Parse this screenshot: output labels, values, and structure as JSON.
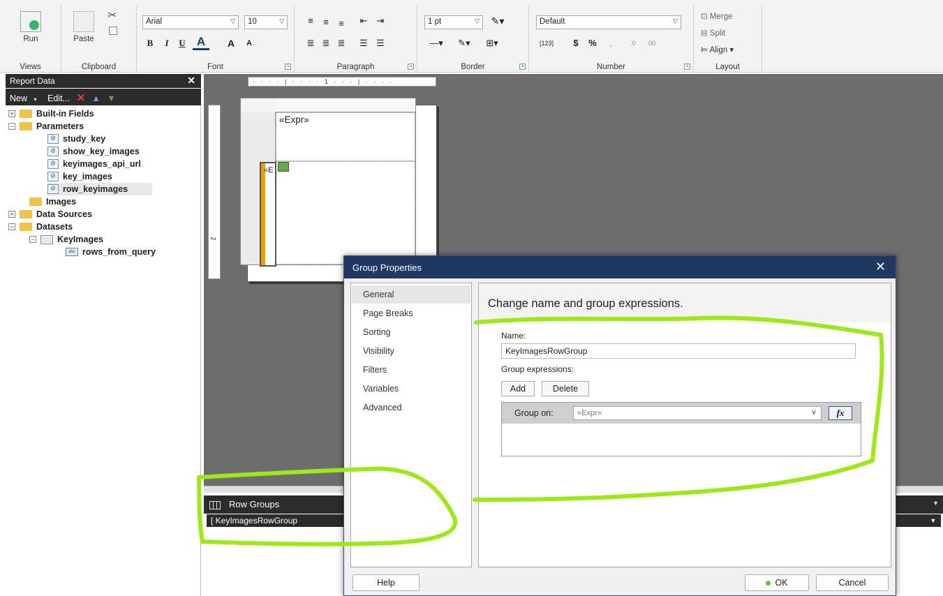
{
  "ribbon": {
    "groups": {
      "views": "Views",
      "clipboard": "Clipboard",
      "font": "Font",
      "paragraph": "Paragraph",
      "border": "Border",
      "number": "Number",
      "layout": "Layout"
    },
    "run_label": "Run",
    "paste_label": "Paste",
    "font_name": "Arial",
    "font_size": "10",
    "border_width": "1 pt",
    "number_format": "Default",
    "merge_label": "Merge",
    "split_label": "Split",
    "align_label": "Align",
    "bold": "B",
    "italic": "I",
    "underline": "U",
    "font_color": "A",
    "grow_font": "A",
    "shrink_font": "A",
    "placeholder_btn": "[123]",
    "currency": "$",
    "percent": "%",
    "comma": ",",
    "inc_decimals": ".0",
    "dec_decimals": ".00"
  },
  "report_data": {
    "title": "Report Data",
    "close": "✕",
    "toolbar": {
      "new": "New",
      "edit": "Edit...",
      "delete_icon": "red-x",
      "up_icon": "arrow-up",
      "down_icon": "arrow-down"
    },
    "tree": [
      {
        "label": "Built-in Fields",
        "type": "folder",
        "exp": "+"
      },
      {
        "label": "Parameters",
        "type": "folder-open",
        "exp": "−"
      },
      {
        "label": "study_key",
        "type": "param"
      },
      {
        "label": "show_key_images",
        "type": "param"
      },
      {
        "label": "keyimages_api_url",
        "type": "param"
      },
      {
        "label": "key_images",
        "type": "param"
      },
      {
        "label": "row_keyimages",
        "type": "param"
      },
      {
        "label": "Images",
        "type": "folder"
      },
      {
        "label": "Data Sources",
        "type": "folder",
        "exp": "+"
      },
      {
        "label": "Datasets",
        "type": "folder-open",
        "exp": "−"
      },
      {
        "label": "KeyImages",
        "type": "dataset",
        "exp": "−"
      },
      {
        "label": "rows_from_query",
        "type": "field"
      }
    ]
  },
  "design": {
    "ruler_top": "· · · · | · · · · 1 · · · | · · · ·",
    "expr_top": "«Expr»",
    "expr_small": "«E",
    "ruler_left_mark": "2"
  },
  "row_groups": {
    "title": "Row Groups",
    "item": "[ KeyImagesRowGroup"
  },
  "dialog": {
    "title": "Group Properties",
    "close": "✕",
    "nav": [
      "General",
      "Page Breaks",
      "Sorting",
      "Visibility",
      "Filters",
      "Variables",
      "Advanced"
    ],
    "active_nav": "General",
    "header": "Change name and group expressions.",
    "name_label": "Name:",
    "name_value": "KeyImagesRowGroup",
    "group_expressions_label": "Group expressions:",
    "add_label": "Add",
    "delete_label": "Delete",
    "group_on_label": "Group on:",
    "group_on_value": "«Expr»",
    "fx_label": "fx",
    "help_label": "Help",
    "ok_label": "OK",
    "cancel_label": "Cancel"
  },
  "colors": {
    "title_bar": "#1f3864",
    "dark_pane": "#2b2b2b",
    "annotation": "#9ee81a",
    "ok_dot": "#5cc93a",
    "selection_bar": "#f0a000"
  }
}
